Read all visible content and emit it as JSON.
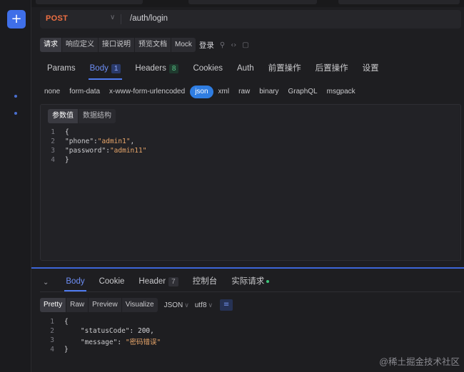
{
  "sidebar": {
    "add_label": "+"
  },
  "request": {
    "method": "POST",
    "url": "/auth/login"
  },
  "toolbar": {
    "buttons": [
      "请求",
      "响应定义",
      "接口说明",
      "预览文档",
      "Mock"
    ],
    "api_name": "登录"
  },
  "request_tabs": [
    {
      "label": "Params"
    },
    {
      "label": "Body",
      "badge": "1"
    },
    {
      "label": "Headers",
      "badge": "8"
    },
    {
      "label": "Cookies"
    },
    {
      "label": "Auth"
    },
    {
      "label": "前置操作"
    },
    {
      "label": "后置操作"
    },
    {
      "label": "设置"
    }
  ],
  "body_types": [
    "none",
    "form-data",
    "x-www-form-urlencoded",
    "json",
    "xml",
    "raw",
    "binary",
    "GraphQL",
    "msgpack"
  ],
  "body_type_selected": "json",
  "body_subtabs": [
    "参数值",
    "数据结构"
  ],
  "request_body_lines": [
    {
      "n": "1",
      "text": "{"
    },
    {
      "n": "2",
      "key": "\"phone\"",
      "sep": ":",
      "val": "\"admin1\"",
      "end": ","
    },
    {
      "n": "3",
      "key": "\"password\"",
      "sep": ":",
      "val": "\"admin11\"",
      "end": ""
    },
    {
      "n": "4",
      "text": "}"
    }
  ],
  "response_tabs": [
    {
      "label": "Body"
    },
    {
      "label": "Cookie"
    },
    {
      "label": "Header",
      "badge": "7"
    },
    {
      "label": "控制台"
    },
    {
      "label": "实际请求"
    }
  ],
  "response_toolbar": {
    "views": [
      "Pretty",
      "Raw",
      "Preview",
      "Visualize"
    ],
    "format": "JSON",
    "encoding": "utf8"
  },
  "response_body_lines": [
    {
      "n": "1",
      "text": "{"
    },
    {
      "n": "2",
      "key": "\"statusCode\"",
      "sep": ": ",
      "val": "200",
      "end": ",",
      "type": "num"
    },
    {
      "n": "3",
      "key": "\"message\"",
      "sep": ": ",
      "val": "\"密码错误\"",
      "end": "",
      "type": "str"
    },
    {
      "n": "4",
      "text": "}"
    }
  ],
  "watermark": "@稀土掘金技术社区",
  "colors": {
    "accent": "#4f7bf0",
    "method_post": "#f07043",
    "json_pill": "#2f7de1",
    "string": "#e8a66a"
  }
}
